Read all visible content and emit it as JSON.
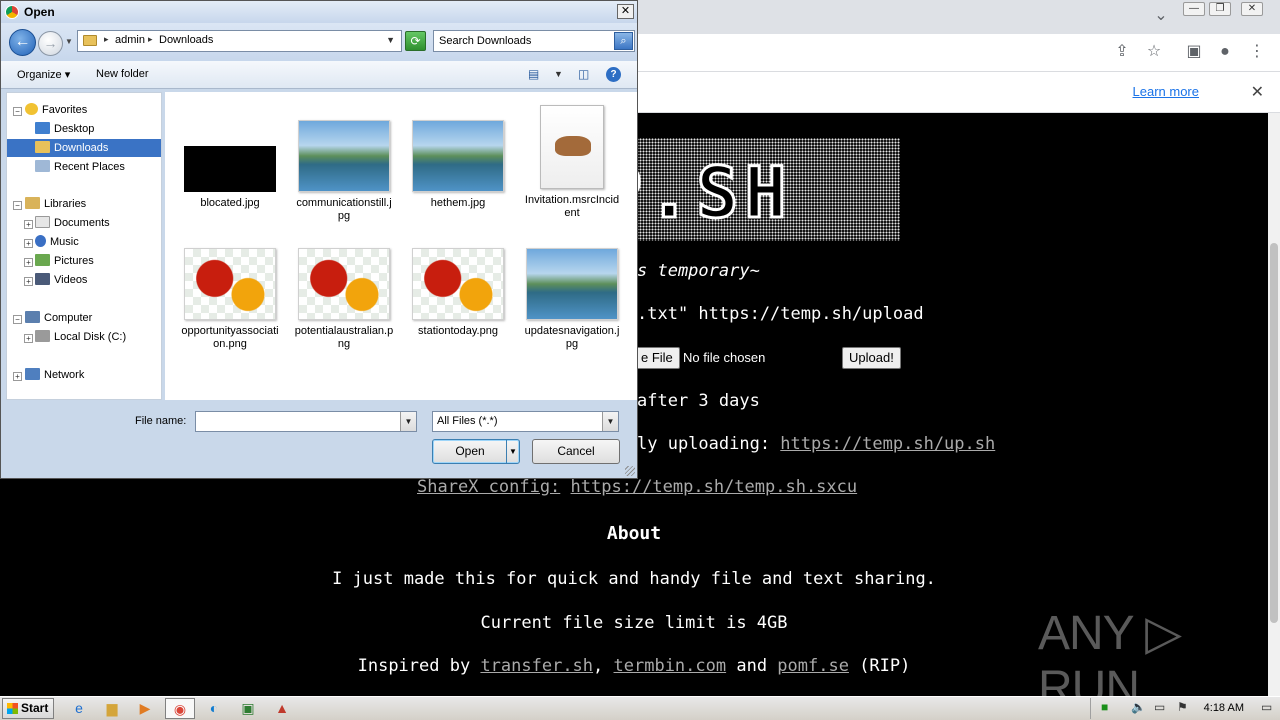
{
  "dialog": {
    "title": "Open",
    "close": "✕",
    "address": {
      "root_arrow": "▸",
      "crumbs": [
        "admin",
        "Downloads"
      ]
    },
    "search": {
      "placeholder": "Search Downloads"
    },
    "toolbar": {
      "organize": "Organize ▾",
      "new_folder": "New folder",
      "help": "?"
    },
    "nav": {
      "favorites": "Favorites",
      "desktop": "Desktop",
      "downloads": "Downloads",
      "recent_places": "Recent Places",
      "libraries": "Libraries",
      "documents": "Documents",
      "music": "Music",
      "pictures": "Pictures",
      "videos": "Videos",
      "computer": "Computer",
      "local_disk": "Local Disk (C:)",
      "network": "Network"
    },
    "files": [
      {
        "name": "blocated.jpg",
        "thumb": "black"
      },
      {
        "name": "communicationstill.jpg",
        "thumb": "landscape"
      },
      {
        "name": "hethem.jpg",
        "thumb": "landscape"
      },
      {
        "name": "Invitation.msrcIncident",
        "thumb": "doc"
      },
      {
        "name": "opportunityassociation.png",
        "thumb": "flower"
      },
      {
        "name": "potentialaustralian.png",
        "thumb": "flower"
      },
      {
        "name": "stationtoday.png",
        "thumb": "flower"
      },
      {
        "name": "updatesnavigation.jpg",
        "thumb": "landscape"
      }
    ],
    "file_name_label": "File name:",
    "file_name_value": "",
    "file_type": "All Files (*.*)",
    "open_label": "Open",
    "cancel_label": "Cancel"
  },
  "browser": {
    "infobar": {
      "learn_more": "Learn more"
    },
    "page": {
      "tagline": "s temporary~",
      "curl_line": ".txt\" https://temp.sh/upload",
      "choose_file": "e File",
      "no_file": "No file chosen",
      "upload": "Upload!",
      "expiry": "after 3 days",
      "script_prefix": "ly uploading: ",
      "script_link": "https://temp.sh/up.sh",
      "sharex_label": "ShareX config:",
      "sharex_link": "https://temp.sh/temp.sh.sxcu",
      "about_heading": "About",
      "about_text": "I just made this for quick and handy file and text sharing.",
      "limit_text": "Current file size limit is 4GB",
      "inspired_prefix": "Inspired by ",
      "inspired_link1": "transfer.sh",
      "sep1": ", ",
      "inspired_link2": "termbin.com",
      "and": " and ",
      "inspired_link3": "pomf.se",
      "rip": " (RIP)"
    },
    "watermark": "ANY ▷ RUN"
  },
  "taskbar": {
    "start": "Start",
    "clock": "4:18 AM"
  }
}
